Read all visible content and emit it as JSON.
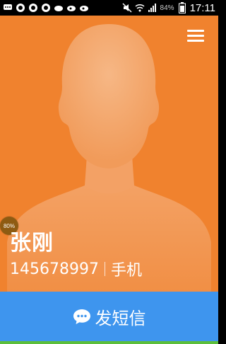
{
  "status_bar": {
    "battery_percent": "84%",
    "time": "17:11",
    "icons": [
      "message-icon",
      "qq-icon",
      "qq-icon",
      "qq-icon",
      "weather-icon",
      "weibo-icon",
      "weibo-icon",
      "mute-icon",
      "wifi-icon",
      "signal-icon",
      "battery-icon"
    ]
  },
  "contact": {
    "name": "张刚",
    "phone": "145678997",
    "phone_type": "手机",
    "badge_text": "80%"
  },
  "actions": {
    "sms_label": "发短信"
  },
  "colors": {
    "contact_bg": "#F0822E",
    "sms_button_bg": "#3E95EE",
    "bottom_strip": "#5BBE3A"
  }
}
